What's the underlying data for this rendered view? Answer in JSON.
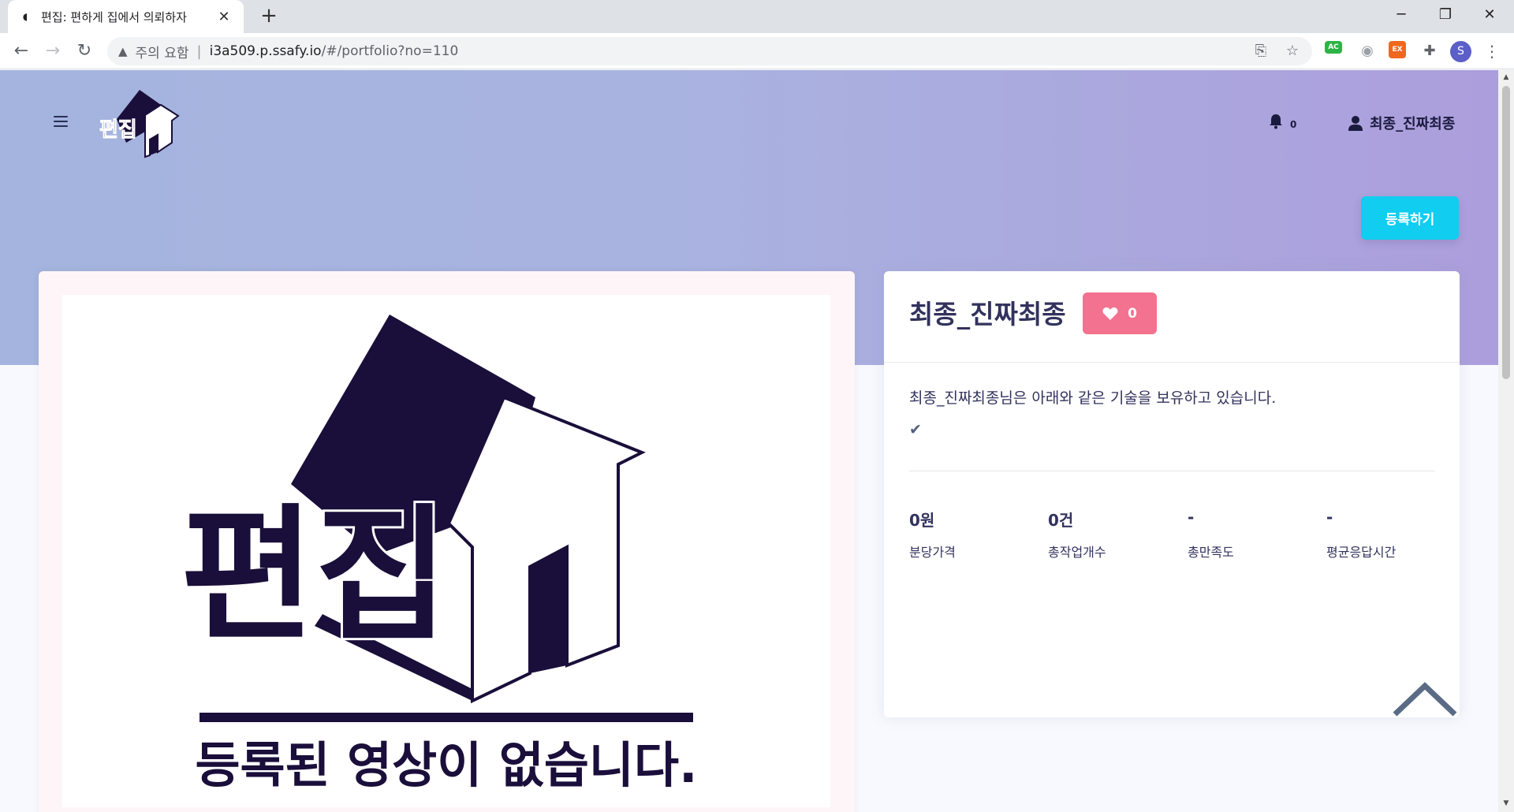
{
  "browser": {
    "tab_title": "편집: 편하게 집에서 의뢰하자",
    "tab_close": "✕",
    "new_tab": "+",
    "window_controls": {
      "minimize": "─",
      "restore": "❐",
      "close": "✕"
    },
    "security_warning": "주의 요함",
    "url_host": "i3a509.p.ssafy.io",
    "url_path": "/#/portfolio?no=110",
    "profile_initial": "S",
    "extensions": [
      {
        "name": "ac-extension",
        "label": "AC",
        "color": "#2fb344"
      },
      {
        "name": "ex-extension",
        "label": "EX",
        "color": "#f0681e"
      }
    ]
  },
  "header": {
    "logo_text": "편집",
    "notification_count": "0",
    "user_name": "최종_진짜최종",
    "register_button": "등록하기"
  },
  "video": {
    "placeholder_logo_text": "편집",
    "placeholder_message": "등록된 영상이 없습니다."
  },
  "profile": {
    "name": "최종_진짜최종",
    "like_count": "0",
    "skills_description": "최종_진짜최종님은 아래와 같은 기술을 보유하고 있습니다.",
    "stats": [
      {
        "value": "0원",
        "label": "분당가격"
      },
      {
        "value": "0건",
        "label": "총작업개수"
      },
      {
        "value": "-",
        "label": "총만족도"
      },
      {
        "value": "-",
        "label": "평균응답시간"
      }
    ]
  },
  "colors": {
    "hero_gradient_start": "#a4b4de",
    "hero_gradient_end": "#ac9edc",
    "register_button": "#11cdef",
    "like_button": "#f3728f",
    "logo_dark": "#1a0e3a"
  }
}
